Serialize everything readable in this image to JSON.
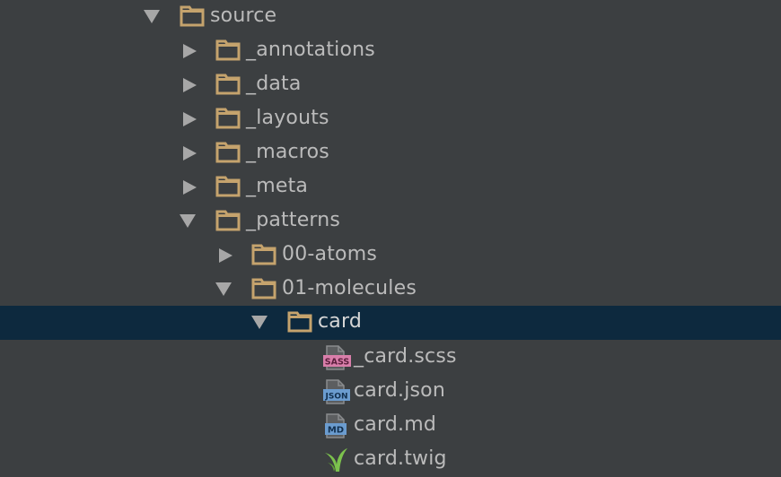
{
  "colors": {
    "background": "#3c3f41",
    "selection": "#0d293e",
    "text": "#bbbbbb",
    "folder": "#c5a36d",
    "arrow": "#a7a7a7",
    "sass_badge": "#d97eaa",
    "json_badge": "#6b9ccf",
    "md_badge": "#6b9ccf",
    "twig_leaf": "#7cc24d"
  },
  "tree": {
    "items": [
      {
        "label": "source",
        "icon": "folder-icon",
        "expanded": true
      },
      {
        "label": "_annotations",
        "icon": "folder-icon",
        "expanded": false
      },
      {
        "label": "_data",
        "icon": "folder-icon",
        "expanded": false
      },
      {
        "label": "_layouts",
        "icon": "folder-icon",
        "expanded": false
      },
      {
        "label": "_macros",
        "icon": "folder-icon",
        "expanded": false
      },
      {
        "label": "_meta",
        "icon": "folder-icon",
        "expanded": false
      },
      {
        "label": "_patterns",
        "icon": "folder-icon",
        "expanded": true
      },
      {
        "label": "00-atoms",
        "icon": "folder-icon",
        "expanded": false
      },
      {
        "label": "01-molecules",
        "icon": "folder-icon",
        "expanded": true
      },
      {
        "label": "card",
        "icon": "folder-icon",
        "expanded": true,
        "selected": true
      },
      {
        "label": "_card.scss",
        "icon": "sass-file-icon",
        "badge": "SASS"
      },
      {
        "label": "card.json",
        "icon": "json-file-icon",
        "badge": "JSON"
      },
      {
        "label": "card.md",
        "icon": "markdown-file-icon",
        "badge": "MD"
      },
      {
        "label": "card.twig",
        "icon": "twig-file-icon"
      }
    ]
  }
}
